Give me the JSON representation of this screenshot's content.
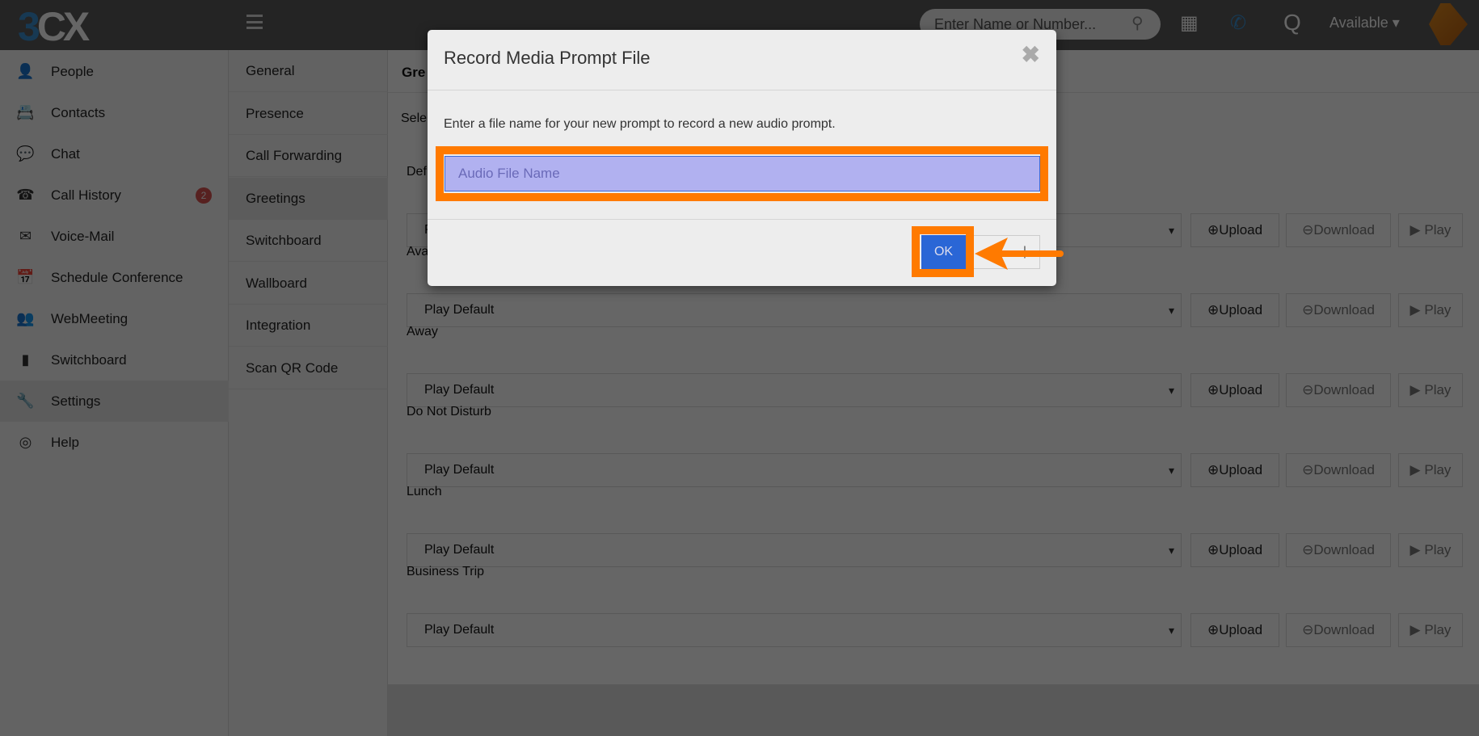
{
  "header": {
    "logo": "3CX",
    "search_placeholder": "Enter Name or Number...",
    "status": "Available"
  },
  "sidebar": {
    "items": [
      {
        "label": "People",
        "icon": "👤"
      },
      {
        "label": "Contacts",
        "icon": "📇"
      },
      {
        "label": "Chat",
        "icon": "💬"
      },
      {
        "label": "Call History",
        "icon": "☎",
        "badge": "2"
      },
      {
        "label": "Voice-Mail",
        "icon": "✉"
      },
      {
        "label": "Schedule Conference",
        "icon": "📅"
      },
      {
        "label": "WebMeeting",
        "icon": "👥"
      },
      {
        "label": "Switchboard",
        "icon": "▮"
      },
      {
        "label": "Settings",
        "icon": "🔧",
        "active": true
      },
      {
        "label": "Help",
        "icon": "◎"
      }
    ]
  },
  "submenu": {
    "items": [
      "General",
      "Presence",
      "Call Forwarding",
      "Greetings",
      "Switchboard",
      "Wallboard",
      "Integration",
      "Scan QR Code"
    ],
    "active": "Greetings"
  },
  "main": {
    "title": "Gre",
    "select_label": "Sele",
    "rows": [
      {
        "label": "Def",
        "value": "Play Default"
      },
      {
        "label": "Ava",
        "value": "Play Default"
      },
      {
        "label": "Away",
        "value": "Play Default"
      },
      {
        "label": "Do Not Disturb",
        "value": "Play Default"
      },
      {
        "label": "Lunch",
        "value": "Play Default"
      },
      {
        "label": "Business Trip",
        "value": "Play Default"
      }
    ],
    "upload": "Upload",
    "download": "Download",
    "play": "Play"
  },
  "dialog": {
    "title": "Record Media Prompt File",
    "instruction": "Enter a file name for your new prompt to record a new audio prompt.",
    "input_placeholder": "Audio File Name",
    "input_value": "",
    "ok": "OK",
    "cancel": "|"
  },
  "annotation_color": "#ff7a00"
}
